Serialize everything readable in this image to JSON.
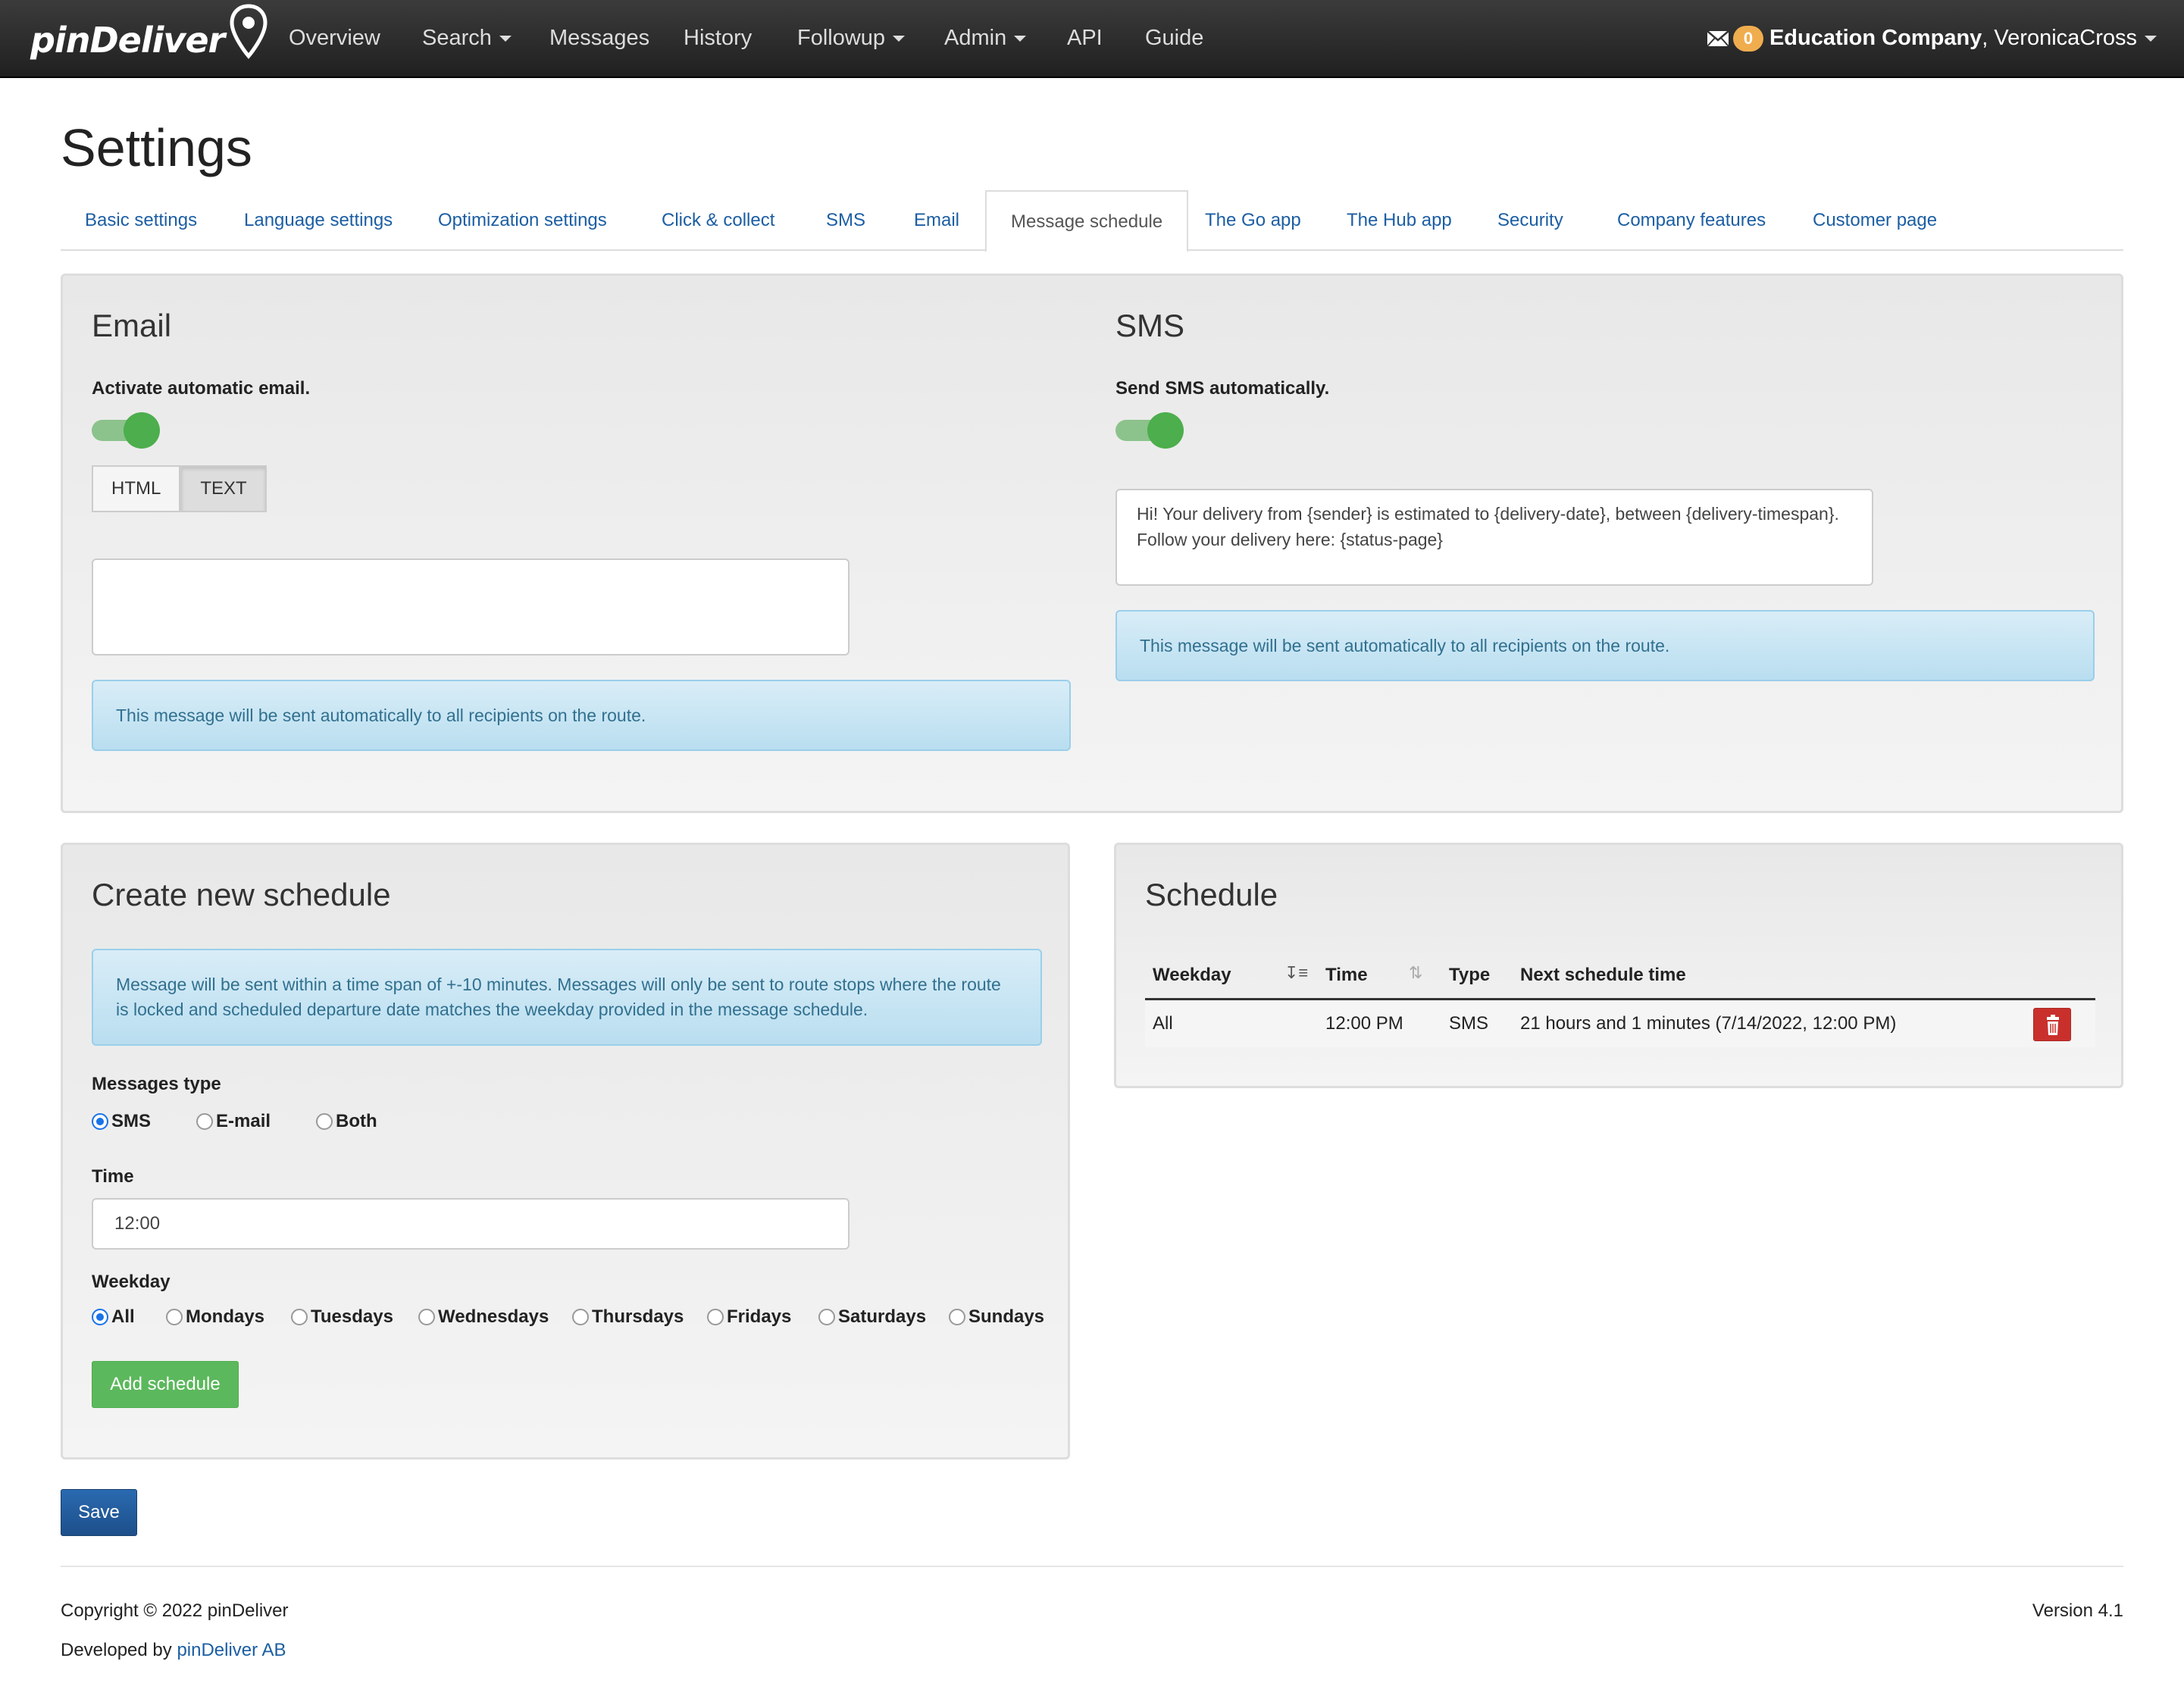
{
  "brand": {
    "name": "pinDeliver"
  },
  "nav": {
    "items": [
      "Overview",
      "Search",
      "Messages",
      "History",
      "Followup",
      "Admin",
      "API",
      "Guide"
    ],
    "mail_count": "0",
    "company": "Education Company",
    "user": ", VeronicaCross"
  },
  "page": {
    "title": "Settings"
  },
  "tabs": [
    "Basic settings",
    "Language settings",
    "Optimization settings",
    "Click & collect",
    "SMS",
    "Email",
    "Message schedule",
    "The Go app",
    "The Hub app",
    "Security",
    "Company features",
    "Customer page"
  ],
  "email_section": {
    "title": "Email",
    "toggle_label": "Activate automatic email.",
    "format_html": "HTML",
    "format_text": "TEXT",
    "message": "",
    "info": "This message will be sent automatically to all recipients on the route."
  },
  "sms_section": {
    "title": "SMS",
    "toggle_label": "Send SMS automatically.",
    "message": "Hi! Your delivery from {sender} is estimated to {delivery-date}, between {delivery-timespan}. Follow your delivery here: {status-page}",
    "info": "This message will be sent automatically to all recipients on the route."
  },
  "create_schedule": {
    "title": "Create new schedule",
    "info": "Message will be sent within a time span of +-10 minutes. Messages will only be sent to route stops where the route is locked and scheduled departure date matches the weekday provided in the message schedule.",
    "type_label": "Messages type",
    "types": [
      "SMS",
      "E-mail",
      "Both"
    ],
    "selected_type": "SMS",
    "time_label": "Time",
    "time_value": "12:00",
    "weekday_label": "Weekday",
    "weekdays": [
      "All",
      "Mondays",
      "Tuesdays",
      "Wednesdays",
      "Thursdays",
      "Fridays",
      "Saturdays",
      "Sundays"
    ],
    "selected_weekday": "All",
    "add_button": "Add schedule"
  },
  "schedule": {
    "title": "Schedule",
    "columns": [
      "Weekday",
      "Time",
      "Type",
      "Next schedule time"
    ],
    "rows": [
      {
        "weekday": "All",
        "time": "12:00 PM",
        "type": "SMS",
        "next": "21 hours and 1 minutes (7/14/2022, 12:00 PM)"
      }
    ]
  },
  "save_button": "Save",
  "footer": {
    "copyright": "Copyright © 2022 pinDeliver",
    "developed_by": "Developed by ",
    "developer": "pinDeliver AB",
    "version": "Version 4.1"
  },
  "colors": {
    "accent": "#1c5ea3",
    "success": "#5cb85c",
    "danger": "#c9302c",
    "info_bg": "#d9edf7"
  }
}
